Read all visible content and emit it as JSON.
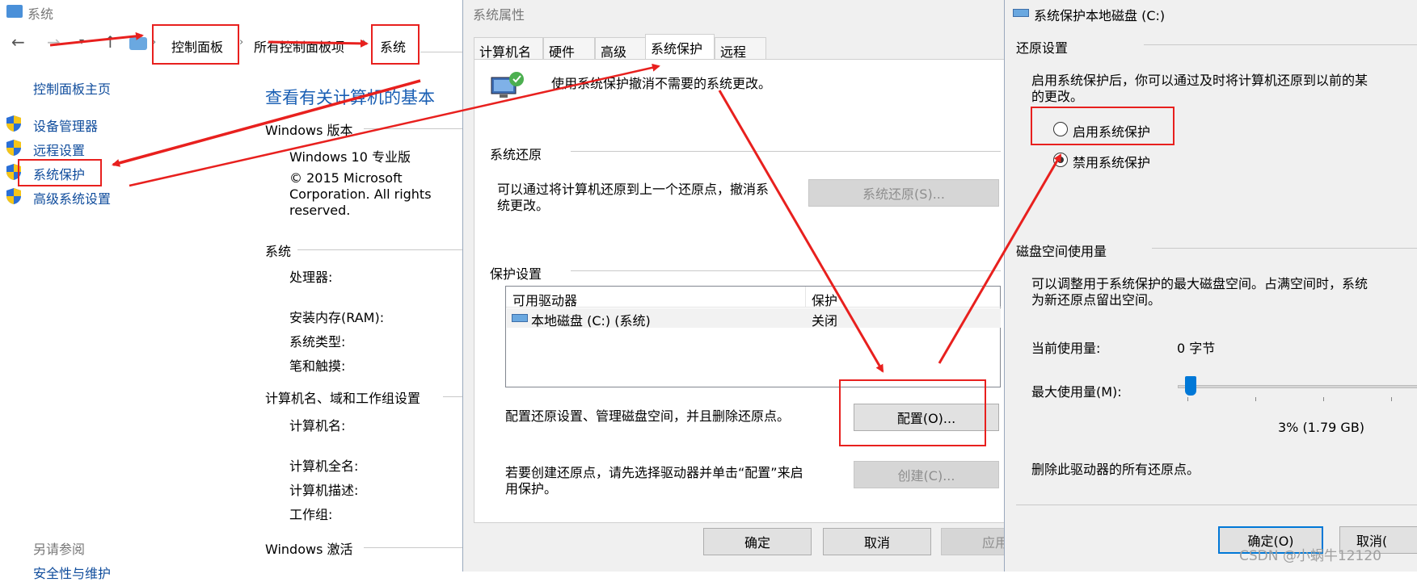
{
  "system_window": {
    "title": "系统",
    "breadcrumb": [
      "控制面板",
      "所有控制面板项",
      "系统"
    ],
    "left_nav": {
      "home": "控制面板主页",
      "items": [
        "设备管理器",
        "远程设置",
        "系统保护",
        "高级系统设置"
      ],
      "see_also": "另请参阅",
      "bottom": "安全性与维护"
    },
    "heading": "查看有关计算机的基本",
    "sections": {
      "edition_header": "Windows 版本",
      "edition": "Windows 10 专业版",
      "copyright": [
        "© 2015 Microsoft",
        "Corporation. All rights",
        "reserved."
      ],
      "system_header": "系统",
      "processor": "处理器:",
      "ram": "安装内存(RAM):",
      "systype": "系统类型:",
      "pen": "笔和触摸:",
      "name_header": "计算机名、域和工作组设置",
      "compname": "计算机名:",
      "fullname": "计算机全名:",
      "desc": "计算机描述:",
      "workgroup": "工作组:",
      "activation_header": "Windows 激活"
    }
  },
  "properties_window": {
    "title": "系统属性",
    "tabs": [
      "计算机名",
      "硬件",
      "高级",
      "系统保护",
      "远程"
    ],
    "active_tab": 3,
    "intro": "使用系统保护撤消不需要的系统更改。",
    "restore_header": "系统还原",
    "restore_text": [
      "可以通过将计算机还原到上一个还原点，撤消系",
      "统更改。"
    ],
    "restore_button": "系统还原(S)...",
    "protection_header": "保护设置",
    "table": {
      "headers": [
        "可用驱动器",
        "保护"
      ],
      "rows": [
        {
          "drive": "本地磁盘 (C:) (系统)",
          "status": "关闭"
        }
      ]
    },
    "config_text": "配置还原设置、管理磁盘空间，并且删除还原点。",
    "config_button": "配置(O)...",
    "create_text": [
      "若要创建还原点，请先选择驱动器并单击“配置”来启",
      "用保护。"
    ],
    "create_button": "创建(C)...",
    "ok": "确定",
    "cancel": "取消",
    "apply": "应用"
  },
  "disk_window": {
    "title": "系统保护本地磁盘 (C:)",
    "restore_header": "还原设置",
    "restore_text": [
      "启用系统保护后，你可以通过及时将计算机还原到以前的某",
      "的更改。"
    ],
    "radio_on": "启用系统保护",
    "radio_off": "禁用系统保护",
    "selected": "禁用系统保护",
    "disk_header": "磁盘空间使用量",
    "disk_text": [
      "可以调整用于系统保护的最大磁盘空间。占满空间时，系统",
      "为新还原点留出空间。"
    ],
    "current_label": "当前使用量:",
    "current_value": "0 字节",
    "max_label": "最大使用量(M):",
    "slider_percent": 3,
    "max_value": "3% (1.79 GB)",
    "delete_text": "删除此驱动器的所有还原点。",
    "ok": "确定(O)",
    "cancel": "取消(",
    "watermark": "CSDN @小蜗牛12120"
  },
  "colors": {
    "annotation": "#e8201e",
    "link": "#0f4c9c",
    "heading": "#1a5fb4"
  }
}
